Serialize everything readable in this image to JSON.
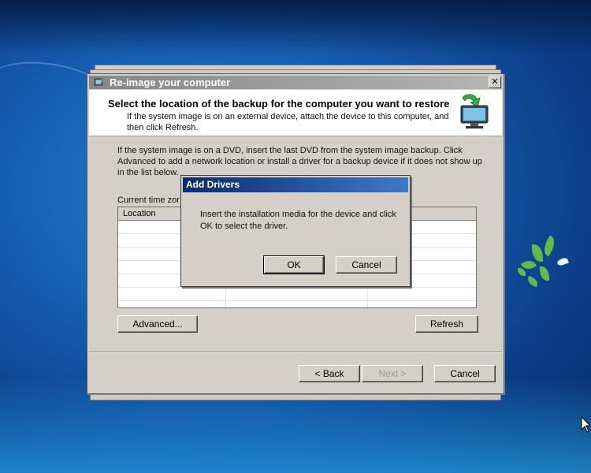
{
  "window": {
    "title": "Re-image your computer",
    "close_glyph": "✕"
  },
  "header": {
    "title": "Select the location of the backup for the computer you want to restore",
    "subtitle": "If the system image is on an external device, attach the device to this computer, and then click Refresh."
  },
  "body": {
    "instructions": "If the system image is on a DVD, insert the last DVD from the system image backup. Click Advanced to add a network location or install a driver for a backup device if it does not show up in the list below.",
    "timezone_label": "Current time zor"
  },
  "list": {
    "columns": [
      "Location",
      "",
      ""
    ],
    "rows": [
      [
        "",
        "",
        ""
      ],
      [
        "",
        "",
        ""
      ],
      [
        "",
        "",
        ""
      ],
      [
        "",
        "",
        ""
      ],
      [
        "",
        "",
        ""
      ],
      [
        "",
        "",
        ""
      ]
    ]
  },
  "buttons": {
    "advanced": "Advanced...",
    "refresh": "Refresh",
    "back": "< Back",
    "next": "Next >",
    "cancel": "Cancel"
  },
  "dialog": {
    "title": "Add Drivers",
    "message": "Insert the installation media for the device and click OK to select the driver.",
    "ok": "OK",
    "cancel": "Cancel"
  },
  "icons": {
    "window_icon": "system-restore-icon",
    "header_icon": "computer-restore-icon",
    "cursor": "mouse-pointer-icon"
  },
  "colors": {
    "desktop": "#1760b4",
    "dialog_face": "#d4d0c8",
    "dialog_titlebar": "#0a2a6e"
  }
}
